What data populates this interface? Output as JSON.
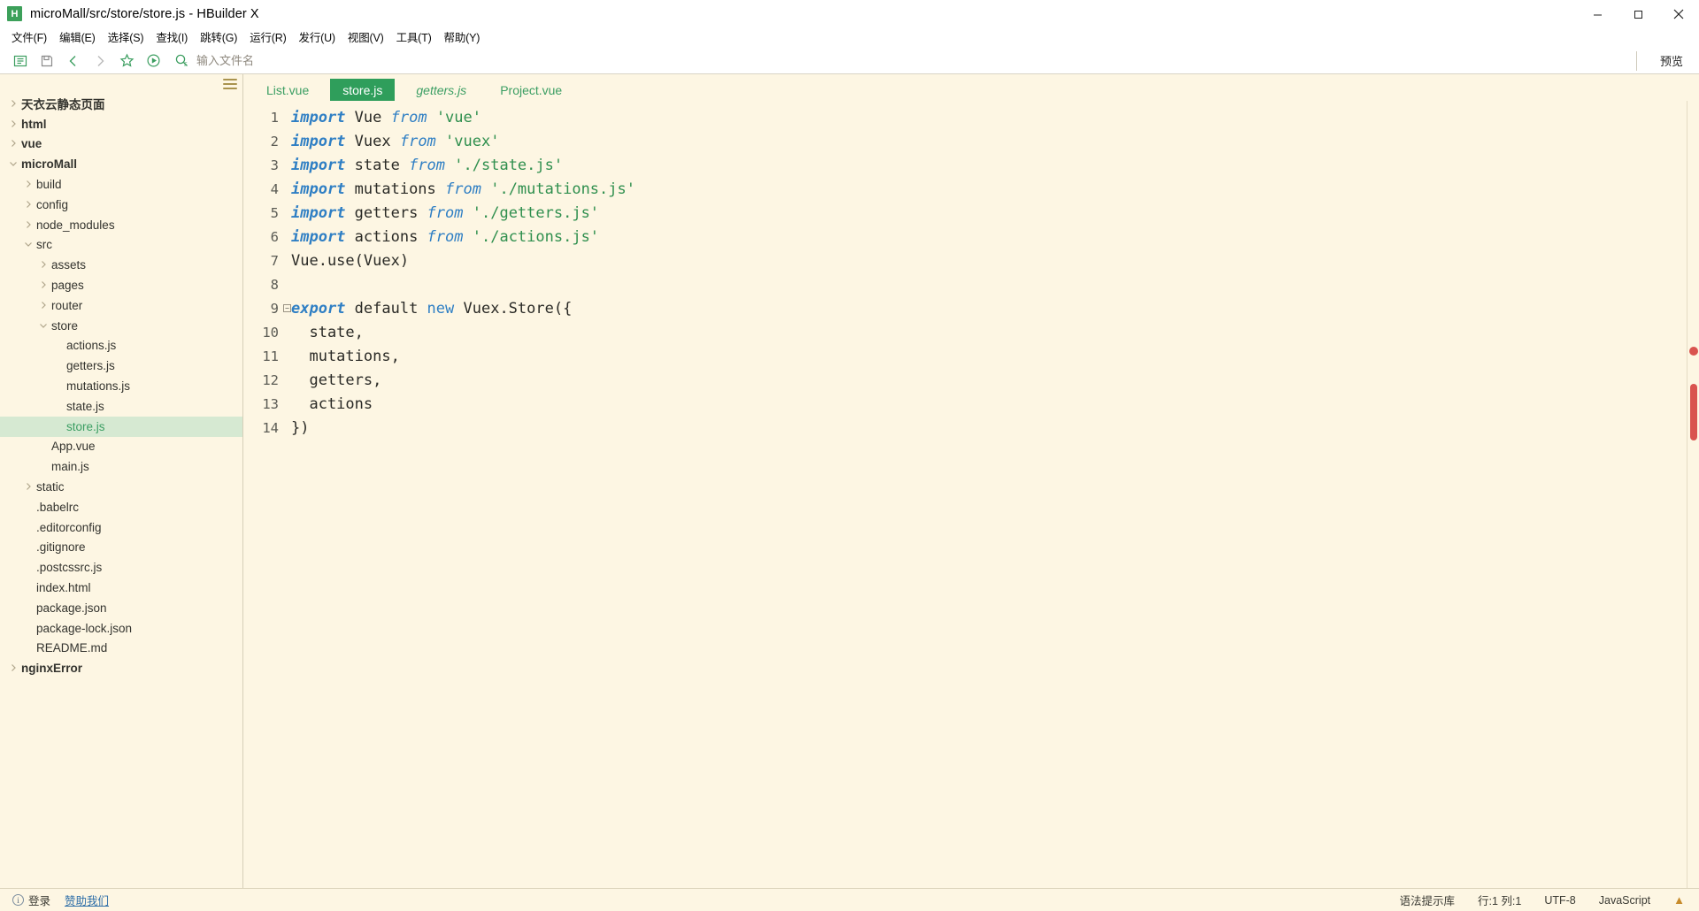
{
  "window": {
    "title": "microMall/src/store/store.js - HBuilder X",
    "app_icon_letter": "H",
    "app_icon_color": "#3ca05a",
    "controls": [
      "minimize",
      "maximize",
      "close"
    ]
  },
  "menubar": {
    "items": [
      {
        "name": "file",
        "label": "文件(F)",
        "text": "文件(",
        "mnemonic": "F"
      },
      {
        "name": "edit",
        "label": "编辑(E)",
        "text": "编辑(",
        "mnemonic": "E"
      },
      {
        "name": "select",
        "label": "选择(S)",
        "text": "选择(",
        "mnemonic": "S"
      },
      {
        "name": "find",
        "label": "查找(I)",
        "text": "查找(",
        "mnemonic": "I"
      },
      {
        "name": "goto",
        "label": "跳转(G)",
        "text": "跳转(",
        "mnemonic": "G"
      },
      {
        "name": "run",
        "label": "运行(R)",
        "text": "运行(",
        "mnemonic": "R"
      },
      {
        "name": "publish",
        "label": "发行(U)",
        "text": "发行(",
        "mnemonic": "U"
      },
      {
        "name": "view",
        "label": "视图(V)",
        "text": "视图(",
        "mnemonic": "V"
      },
      {
        "name": "tools",
        "label": "工具(T)",
        "text": "工具(",
        "mnemonic": "T"
      },
      {
        "name": "help",
        "label": "帮助(Y)",
        "text": "帮助(",
        "mnemonic": "Y"
      }
    ]
  },
  "toolbar": {
    "buttons": [
      {
        "name": "toggle-sidebar-icon",
        "icon": "panel-left"
      },
      {
        "name": "save-icon",
        "icon": "floppy-disk"
      },
      {
        "name": "back-icon",
        "icon": "chevron-left"
      },
      {
        "name": "forward-icon",
        "icon": "chevron-right"
      },
      {
        "name": "favorite-icon",
        "icon": "star"
      },
      {
        "name": "run-icon",
        "icon": "play-circle"
      }
    ],
    "search": {
      "icon": "search-icon",
      "placeholder": "输入文件名",
      "value": ""
    },
    "preview_label": "预览"
  },
  "sidebar": {
    "menu_icon": "hamburger-icon",
    "tree": [
      {
        "label": "天衣云静态页面",
        "depth": 0,
        "arrow": "right",
        "bold": true,
        "selected": false
      },
      {
        "label": "html",
        "depth": 0,
        "arrow": "right",
        "bold": true,
        "selected": false
      },
      {
        "label": "vue",
        "depth": 0,
        "arrow": "right",
        "bold": true,
        "selected": false
      },
      {
        "label": "microMall",
        "depth": 0,
        "arrow": "down",
        "bold": true,
        "selected": false
      },
      {
        "label": "build",
        "depth": 1,
        "arrow": "right",
        "bold": false,
        "selected": false
      },
      {
        "label": "config",
        "depth": 1,
        "arrow": "right",
        "bold": false,
        "selected": false
      },
      {
        "label": "node_modules",
        "depth": 1,
        "arrow": "right",
        "bold": false,
        "selected": false
      },
      {
        "label": "src",
        "depth": 1,
        "arrow": "down",
        "bold": false,
        "selected": false
      },
      {
        "label": "assets",
        "depth": 2,
        "arrow": "right",
        "bold": false,
        "selected": false
      },
      {
        "label": "pages",
        "depth": 2,
        "arrow": "right",
        "bold": false,
        "selected": false
      },
      {
        "label": "router",
        "depth": 2,
        "arrow": "right",
        "bold": false,
        "selected": false
      },
      {
        "label": "store",
        "depth": 2,
        "arrow": "down",
        "bold": false,
        "selected": false
      },
      {
        "label": "actions.js",
        "depth": 3,
        "arrow": "none",
        "bold": false,
        "selected": false
      },
      {
        "label": "getters.js",
        "depth": 3,
        "arrow": "none",
        "bold": false,
        "selected": false
      },
      {
        "label": "mutations.js",
        "depth": 3,
        "arrow": "none",
        "bold": false,
        "selected": false
      },
      {
        "label": "state.js",
        "depth": 3,
        "arrow": "none",
        "bold": false,
        "selected": false
      },
      {
        "label": "store.js",
        "depth": 3,
        "arrow": "none",
        "bold": false,
        "selected": true
      },
      {
        "label": "App.vue",
        "depth": 2,
        "arrow": "none",
        "bold": false,
        "selected": false
      },
      {
        "label": "main.js",
        "depth": 2,
        "arrow": "none",
        "bold": false,
        "selected": false
      },
      {
        "label": "static",
        "depth": 1,
        "arrow": "right",
        "bold": false,
        "selected": false
      },
      {
        "label": ".babelrc",
        "depth": 1,
        "arrow": "none",
        "bold": false,
        "selected": false
      },
      {
        "label": ".editorconfig",
        "depth": 1,
        "arrow": "none",
        "bold": false,
        "selected": false
      },
      {
        "label": ".gitignore",
        "depth": 1,
        "arrow": "none",
        "bold": false,
        "selected": false
      },
      {
        "label": ".postcssrc.js",
        "depth": 1,
        "arrow": "none",
        "bold": false,
        "selected": false
      },
      {
        "label": "index.html",
        "depth": 1,
        "arrow": "none",
        "bold": false,
        "selected": false
      },
      {
        "label": "package.json",
        "depth": 1,
        "arrow": "none",
        "bold": false,
        "selected": false
      },
      {
        "label": "package-lock.json",
        "depth": 1,
        "arrow": "none",
        "bold": false,
        "selected": false
      },
      {
        "label": "README.md",
        "depth": 1,
        "arrow": "none",
        "bold": false,
        "selected": false
      },
      {
        "label": "nginxError",
        "depth": 0,
        "arrow": "right",
        "bold": true,
        "selected": false
      }
    ]
  },
  "editor": {
    "tabs": [
      {
        "label": "List.vue",
        "active": false,
        "italic": false
      },
      {
        "label": "store.js",
        "active": true,
        "italic": false
      },
      {
        "label": "getters.js",
        "active": false,
        "italic": true
      },
      {
        "label": "Project.vue",
        "active": false,
        "italic": false
      }
    ],
    "active_tab_color": "#2f9e5b",
    "lines": [
      {
        "n": "1",
        "fold": false,
        "tokens": [
          {
            "t": "import",
            "c": "k-import"
          },
          {
            "t": " Vue ",
            "c": "k-plain"
          },
          {
            "t": "from",
            "c": "k-from"
          },
          {
            "t": " ",
            "c": "k-plain"
          },
          {
            "t": "'vue'",
            "c": "k-str"
          }
        ]
      },
      {
        "n": "2",
        "fold": false,
        "tokens": [
          {
            "t": "import",
            "c": "k-import"
          },
          {
            "t": " Vuex ",
            "c": "k-plain"
          },
          {
            "t": "from",
            "c": "k-from"
          },
          {
            "t": " ",
            "c": "k-plain"
          },
          {
            "t": "'vuex'",
            "c": "k-str"
          }
        ]
      },
      {
        "n": "3",
        "fold": false,
        "tokens": [
          {
            "t": "import",
            "c": "k-import"
          },
          {
            "t": " state ",
            "c": "k-plain"
          },
          {
            "t": "from",
            "c": "k-from"
          },
          {
            "t": " ",
            "c": "k-plain"
          },
          {
            "t": "'./state.js'",
            "c": "k-str"
          }
        ]
      },
      {
        "n": "4",
        "fold": false,
        "tokens": [
          {
            "t": "import",
            "c": "k-import"
          },
          {
            "t": " mutations ",
            "c": "k-plain"
          },
          {
            "t": "from",
            "c": "k-from"
          },
          {
            "t": " ",
            "c": "k-plain"
          },
          {
            "t": "'./mutations.js'",
            "c": "k-str"
          }
        ]
      },
      {
        "n": "5",
        "fold": false,
        "tokens": [
          {
            "t": "import",
            "c": "k-import"
          },
          {
            "t": " getters ",
            "c": "k-plain"
          },
          {
            "t": "from",
            "c": "k-from"
          },
          {
            "t": " ",
            "c": "k-plain"
          },
          {
            "t": "'./getters.js'",
            "c": "k-str"
          }
        ]
      },
      {
        "n": "6",
        "fold": false,
        "tokens": [
          {
            "t": "import",
            "c": "k-import"
          },
          {
            "t": " actions ",
            "c": "k-plain"
          },
          {
            "t": "from",
            "c": "k-from"
          },
          {
            "t": " ",
            "c": "k-plain"
          },
          {
            "t": "'./actions.js'",
            "c": "k-str"
          }
        ]
      },
      {
        "n": "7",
        "fold": false,
        "tokens": [
          {
            "t": "Vue.use(Vuex)",
            "c": "k-plain"
          }
        ]
      },
      {
        "n": "8",
        "fold": false,
        "tokens": [
          {
            "t": "",
            "c": "k-plain"
          }
        ]
      },
      {
        "n": "9",
        "fold": true,
        "tokens": [
          {
            "t": "export",
            "c": "k-export"
          },
          {
            "t": " default ",
            "c": "k-plain"
          },
          {
            "t": "new",
            "c": "k-new"
          },
          {
            "t": " Vuex.Store({",
            "c": "k-plain"
          }
        ]
      },
      {
        "n": "10",
        "fold": false,
        "tokens": [
          {
            "t": "  state,",
            "c": "k-plain"
          }
        ]
      },
      {
        "n": "11",
        "fold": false,
        "tokens": [
          {
            "t": "  mutations,",
            "c": "k-plain"
          }
        ]
      },
      {
        "n": "12",
        "fold": false,
        "tokens": [
          {
            "t": "  getters,",
            "c": "k-plain"
          }
        ]
      },
      {
        "n": "13",
        "fold": false,
        "tokens": [
          {
            "t": "  actions",
            "c": "k-plain"
          }
        ]
      },
      {
        "n": "14",
        "fold": false,
        "tokens": [
          {
            "t": "})",
            "c": "k-plain"
          }
        ]
      }
    ]
  },
  "statusbar": {
    "login_label": "登录",
    "sponsor_label": "赞助我们",
    "syntax_label": "语法提示库",
    "cursor_label": "行:1  列:1",
    "encoding_label": "UTF-8",
    "language_label": "JavaScript",
    "bell_icon": "bell-icon"
  }
}
